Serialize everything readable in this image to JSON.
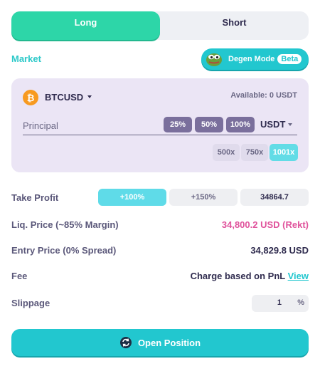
{
  "side_toggle": {
    "long_label": "Long",
    "short_label": "Short",
    "selected": "Long"
  },
  "market": {
    "label": "Market",
    "degen_mode": {
      "label": "Degen Mode",
      "badge": "Beta",
      "icon": "pepe-frog-icon"
    }
  },
  "order_panel": {
    "pair": "BTCUSD",
    "pair_icon": "bitcoin-icon",
    "available": "Available: 0 USDT",
    "principal_placeholder": "Principal",
    "percent_buttons": [
      "25%",
      "50%",
      "100%"
    ],
    "unit": "USDT",
    "leverage_options": [
      "500x",
      "750x",
      "1001x"
    ],
    "leverage_selected": "1001x"
  },
  "details": {
    "take_profit": {
      "label": "Take Profit",
      "options": [
        "+100%",
        "+150%"
      ],
      "selected": "+100%",
      "price": "34864.7"
    },
    "liq_price": {
      "label": "Liq. Price (~85% Margin)",
      "value": "34,800.2 USD (Rekt)"
    },
    "entry_price": {
      "label": "Entry Price (0% Spread)",
      "value": "34,829.8 USD"
    },
    "fee": {
      "label": "Fee",
      "value": "Charge based on PnL",
      "link": "View"
    },
    "slippage": {
      "label": "Slippage",
      "value": "1",
      "unit": "%"
    }
  },
  "submit": {
    "label": "Open Position",
    "icon": "swap-refresh-icon"
  },
  "colors": {
    "accent": "#22c7cf",
    "long": "#2dd6a8",
    "panel": "#ebe5f5",
    "liq": "#e0539c",
    "percent_btn": "#7a6f9c"
  }
}
